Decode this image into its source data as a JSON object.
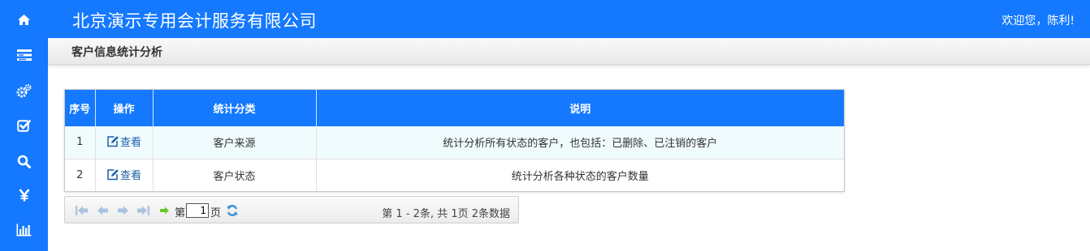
{
  "header": {
    "company": "北京演示专用会计服务有限公司",
    "welcome": "欢迎您，陈利!"
  },
  "sidebar": {
    "items": [
      {
        "icon": "home-icon"
      },
      {
        "icon": "list-icon"
      },
      {
        "icon": "gears-icon"
      },
      {
        "icon": "check-square-icon"
      },
      {
        "icon": "search-icon"
      },
      {
        "icon": "yen-icon"
      },
      {
        "icon": "bar-chart-icon"
      }
    ]
  },
  "breadcrumb": {
    "title": "客户信息统计分析"
  },
  "grid": {
    "columns": [
      "序号",
      "操作",
      "统计分类",
      "说明"
    ],
    "rows": [
      {
        "index": "1",
        "action": "查看",
        "category": "客户来源",
        "description": "统计分析所有状态的客户，也包括：已删除、已注销的客户"
      },
      {
        "index": "2",
        "action": "查看",
        "category": "客户状态",
        "description": "统计分析各种状态的客户数量"
      }
    ]
  },
  "pager": {
    "page_prefix": "第",
    "page_value": "1",
    "page_suffix": "页",
    "summary": "第 1 - 2条, 共 1页 2条数据"
  },
  "colors": {
    "primary": "#1479ff",
    "row_alt": "#f0fbfd",
    "link": "#1b5fa8"
  }
}
